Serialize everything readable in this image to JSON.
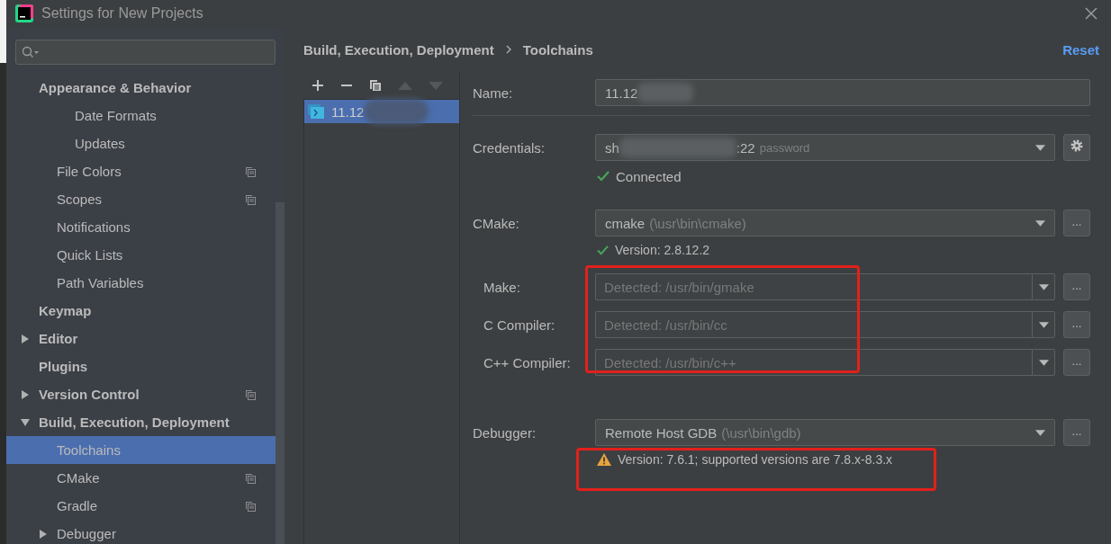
{
  "window": {
    "title": "Settings for New Projects"
  },
  "tree": [
    {
      "label": "Appearance & Behavior",
      "selected": false,
      "copy_icon": false,
      "children": [
        {
          "children": [
            {
              "label": "Date Formats",
              "selected": false,
              "copy_icon": false
            },
            {
              "label": "Updates",
              "selected": false,
              "copy_icon": false
            }
          ]
        },
        {
          "label": "File Colors",
          "selected": false,
          "copy_icon": true
        },
        {
          "label": "Scopes",
          "selected": false,
          "copy_icon": true
        },
        {
          "label": "Notifications",
          "selected": false,
          "copy_icon": false
        },
        {
          "label": "Quick Lists",
          "selected": false,
          "copy_icon": false
        },
        {
          "label": "Path Variables",
          "selected": false,
          "copy_icon": false
        }
      ]
    },
    {
      "label": "Keymap",
      "selected": false,
      "copy_icon": false
    },
    {
      "label": "Editor",
      "selected": false,
      "copy_icon": false,
      "expanded": false
    },
    {
      "label": "Plugins",
      "selected": false,
      "copy_icon": false
    },
    {
      "label": "Version Control",
      "selected": false,
      "copy_icon": true,
      "expanded": false
    },
    {
      "label": "Build, Execution, Deployment",
      "selected": false,
      "copy_icon": false,
      "expanded": true,
      "children": [
        {
          "label": "Toolchains",
          "selected": true,
          "copy_icon": false
        },
        {
          "label": "CMake",
          "selected": false,
          "copy_icon": true
        },
        {
          "label": "Gradle",
          "selected": false,
          "copy_icon": true
        },
        {
          "label": "Debugger",
          "selected": false,
          "copy_icon": false,
          "expanded": false
        }
      ]
    }
  ],
  "breadcrumb": [
    "Build, Execution, Deployment",
    "Toolchains"
  ],
  "reset": "Reset",
  "toolchains": [
    {
      "label": "11.12",
      "selected": true
    }
  ],
  "form": {
    "name": {
      "label": "Name:",
      "value": "11.12"
    },
    "credentials": {
      "label": "Credentials:",
      "value_start": "sh",
      "value_end": ":22",
      "hint": "password",
      "status": {
        "kind": "ok",
        "text": "Connected"
      }
    },
    "cmake": {
      "label": "CMake:",
      "value": "cmake",
      "hint": "(\\usr\\bin\\cmake)",
      "button": "...",
      "status": {
        "kind": "ok",
        "text": "Version: 2.8.12.2"
      }
    },
    "tools": [
      {
        "label": "Make:",
        "placeholder": "Detected: /usr/bin/gmake",
        "button": "..."
      },
      {
        "label": "C Compiler:",
        "placeholder": "Detected: /usr/bin/cc",
        "button": "..."
      },
      {
        "label": "C++ Compiler:",
        "placeholder": "Detected: /usr/bin/c++",
        "button": "..."
      }
    ],
    "debugger": {
      "label": "Debugger:",
      "value": "Remote Host GDB",
      "hint": "(\\usr\\bin\\gdb)",
      "button": "...",
      "status": {
        "kind": "warning",
        "text": "Version: 7.6.1; supported versions are 7.8.x-8.3.x"
      }
    }
  }
}
